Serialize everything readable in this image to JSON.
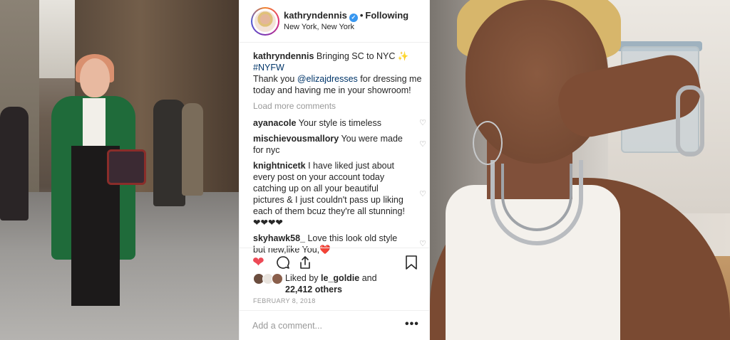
{
  "post": {
    "username": "kathryndennis",
    "following_label": "Following",
    "location": "New York, New York",
    "caption": {
      "user": "kathryndennis",
      "text_1": "Bringing SC to NYC ✨",
      "hashtag": "#NYFW",
      "text_2": "Thank you ",
      "mention": "@elizajdresses",
      "text_3": " for dressing me today and having me in your showroom!"
    },
    "load_more": "Load more comments",
    "comments": [
      {
        "user": "ayanacole",
        "text": "Your style is timeless"
      },
      {
        "user": "mischievousmallory",
        "text": "You were made for nyc"
      },
      {
        "user": "knightnicetk",
        "text": "I have liked just about every post on your account today catching up on all your beautiful pictures & I just couldn't pass up liking each of them bcuz they're all stunning! ❤❤❤❤"
      },
      {
        "user": "skyhawk58_",
        "text": "Love this look old style but new,like You,❤️"
      }
    ],
    "likes": {
      "prefix": "Liked by",
      "user": "le_goldie",
      "and": "and",
      "others": "22,412 others"
    },
    "date": "FEBRUARY 8, 2018",
    "add_comment_placeholder": "Add a comment...",
    "more_label": "•••"
  },
  "icons": {
    "heart": "heart-icon",
    "comment": "comment-icon",
    "share": "share-icon",
    "save": "bookmark-icon",
    "verified": "verified-badge-icon"
  },
  "colors": {
    "like_red": "#ed4956",
    "verified_blue": "#3897f0",
    "link_blue": "#003569",
    "muted_gray": "#999999"
  }
}
